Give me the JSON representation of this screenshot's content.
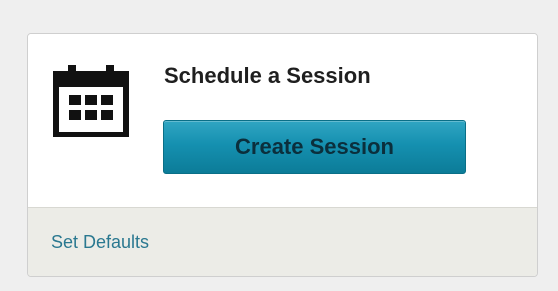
{
  "card": {
    "icon": "calendar-icon",
    "title": "Schedule a Session",
    "create_button_label": "Create Session",
    "footer_link_label": "Set Defaults"
  },
  "colors": {
    "button_top": "#30a5c2",
    "button_bottom": "#0c7c98",
    "button_text": "#0b2f3c",
    "link": "#2a7890",
    "footer_bg": "#ecece7"
  }
}
